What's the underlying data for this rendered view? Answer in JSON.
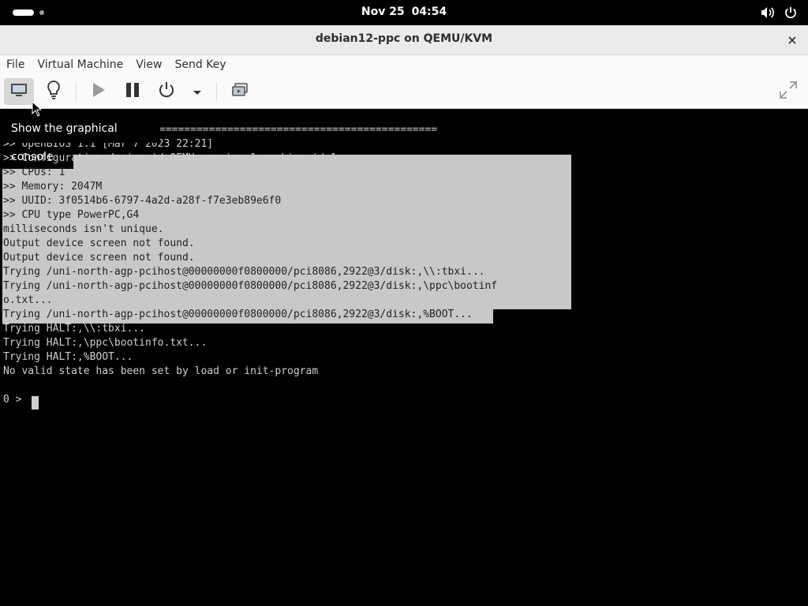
{
  "topbar": {
    "date": "Nov 25",
    "time": "04:54",
    "icons": [
      "activities-indicator",
      "volume-icon",
      "power-icon"
    ]
  },
  "window": {
    "title": "debian12-ppc on QEMU/KVM"
  },
  "menubar": {
    "items": [
      "File",
      "Virtual Machine",
      "View",
      "Send Key"
    ]
  },
  "toolbar": {
    "buttons": [
      "console-icon",
      "details-lightbulb-icon",
      "run-icon",
      "pause-icon",
      "shutdown-icon",
      "shutdown-menu-chevron",
      "snapshots-icon",
      "fullscreen-icon"
    ]
  },
  "tooltip": "Show the graphical console",
  "console": {
    "lines": [
      "=============================================",
      ">> OpenBIOS 1.1 [Mar 7 2023 22:21]",
      ">> Configuration device id QEMU version 1 machine id 1",
      ">> CPUs: 1",
      ">> Memory: 2047M",
      ">> UUID: 3f0514b6-6797-4a2d-a28f-f7e3eb89e6f0",
      ">> CPU type PowerPC,G4",
      "milliseconds isn't unique.",
      "Output device screen not found.",
      "Output device screen not found.",
      "Trying /uni-north-agp-pcihost@00000000f0800000/pci8086,2922@3/disk:,\\\\:tbxi...",
      "Trying /uni-north-agp-pcihost@00000000f0800000/pci8086,2922@3/disk:,\\ppc\\bootinf",
      "o.txt...",
      "Trying /uni-north-agp-pcihost@00000000f0800000/pci8086,2922@3/disk:,%BOOT...",
      "Trying HALT:,\\\\:tbxi...",
      "Trying HALT:,\\ppc\\bootinfo.txt...",
      "Trying HALT:,%BOOT...",
      "No valid state has been set by load or init-program",
      "",
      "0 > "
    ]
  },
  "colors": {
    "console_bg": "#000000",
    "console_fg": "#cfcfcf",
    "selection": "#c8c8c8",
    "headerbar": "#ebebeb"
  }
}
